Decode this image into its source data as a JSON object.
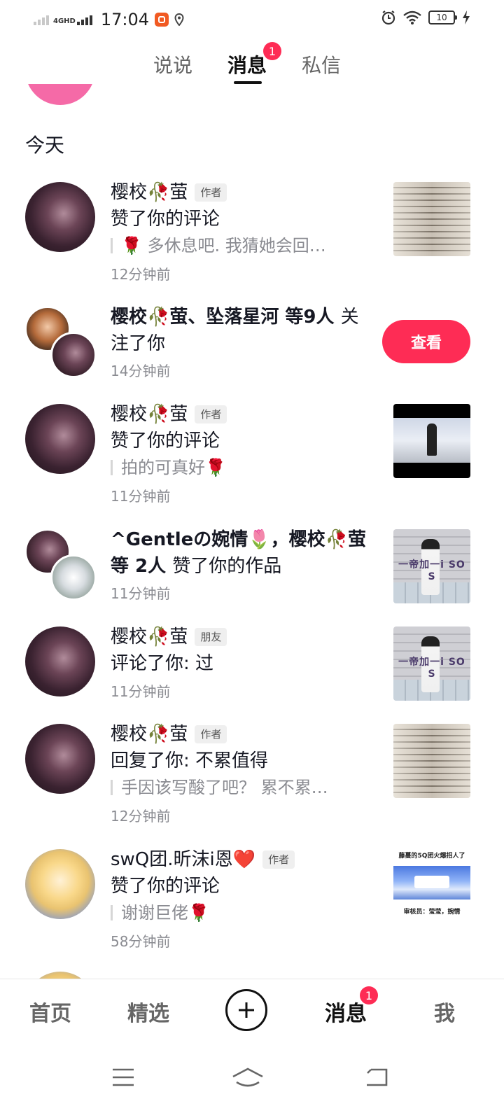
{
  "status_bar": {
    "network": "4GHD",
    "time": "17:04",
    "battery": "10"
  },
  "top_tabs": [
    {
      "label": "说说",
      "active": false
    },
    {
      "label": "消息",
      "active": true,
      "badge": "1"
    },
    {
      "label": "私信",
      "active": false
    }
  ],
  "section_title": "今天",
  "notifications": [
    {
      "name": "樱校🥀萤",
      "tag": "作者",
      "action": "赞了你的评论",
      "quote": "🌹 多休息吧. 我猜她会回…",
      "time": "12分钟前"
    },
    {
      "text": "樱校🥀萤、坠落星河 等9人",
      "text_suffix": "关注了你",
      "time": "14分钟前",
      "button": "查看"
    },
    {
      "name": "樱校🥀萤",
      "tag": "作者",
      "action": "赞了你的评论",
      "quote": "拍的可真好🌹",
      "time": "11分钟前"
    },
    {
      "text": "^Gentleの婉情🌷，樱校🥀萤 等 2人",
      "text_suffix": "赞了你的作品",
      "time": "11分钟前",
      "thumb_text": "一帝加一i SO S"
    },
    {
      "name": "樱校🥀萤",
      "tag": "朋友",
      "action": "评论了你: 过",
      "time": "11分钟前",
      "thumb_text": "一帝加一i SO S"
    },
    {
      "name": "樱校🥀萤",
      "tag": "作者",
      "action": "回复了你: 不累值得",
      "quote": "手因该写酸了吧？ 累不累…",
      "time": "12分钟前"
    },
    {
      "name": "swQ团.昕沫i恩❤️",
      "tag": "作者",
      "action": "赞了你的评论",
      "quote": "谢谢巨佬🌹",
      "time": "58分钟前",
      "thumb_title": "藤蔓的5Q团火爆招人了",
      "thumb_footer": "审核员：莹莹，婉情"
    }
  ],
  "bottom_nav": [
    {
      "label": "首页",
      "active": false
    },
    {
      "label": "精选",
      "active": false
    },
    {
      "label": "消息",
      "active": true,
      "badge": "1"
    },
    {
      "label": "我",
      "active": false
    }
  ]
}
